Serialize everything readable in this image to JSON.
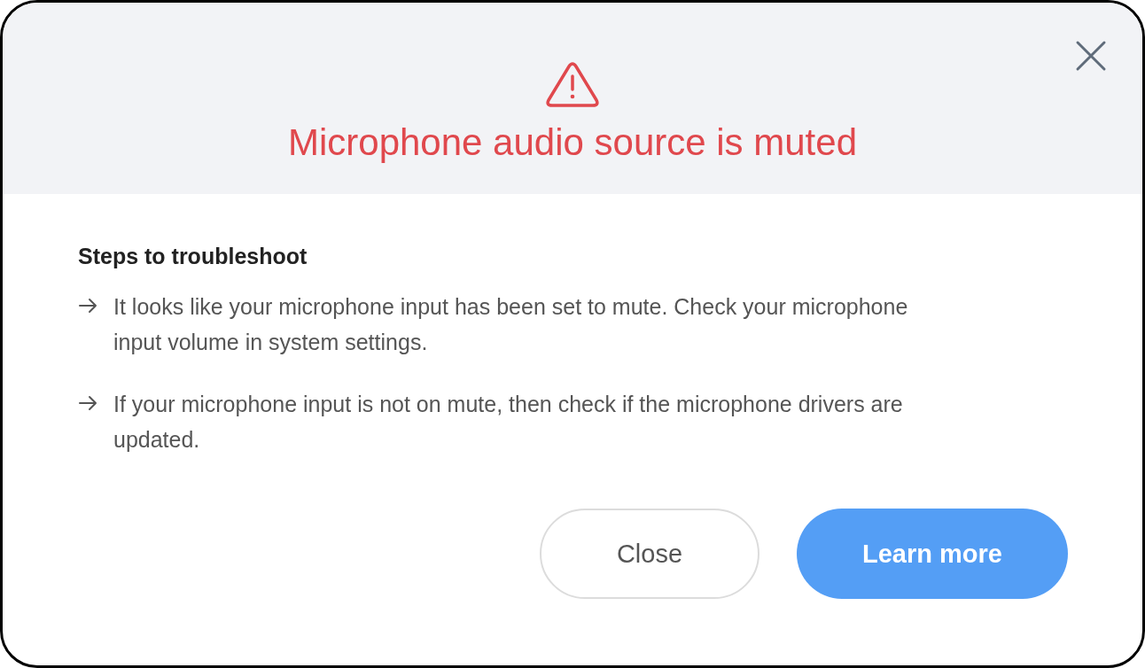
{
  "dialog": {
    "title": "Microphone audio source is muted"
  },
  "section": {
    "heading": "Steps to troubleshoot",
    "steps": [
      {
        "text": "It looks like your microphone input has been set to mute. Check your microphone input volume in system settings."
      },
      {
        "text": "If your microphone input is not on mute, then check if the microphone drivers are updated."
      }
    ]
  },
  "buttons": [
    {
      "label": "Close",
      "kind": "secondary"
    },
    {
      "label": "Learn more",
      "kind": "primary"
    }
  ]
}
